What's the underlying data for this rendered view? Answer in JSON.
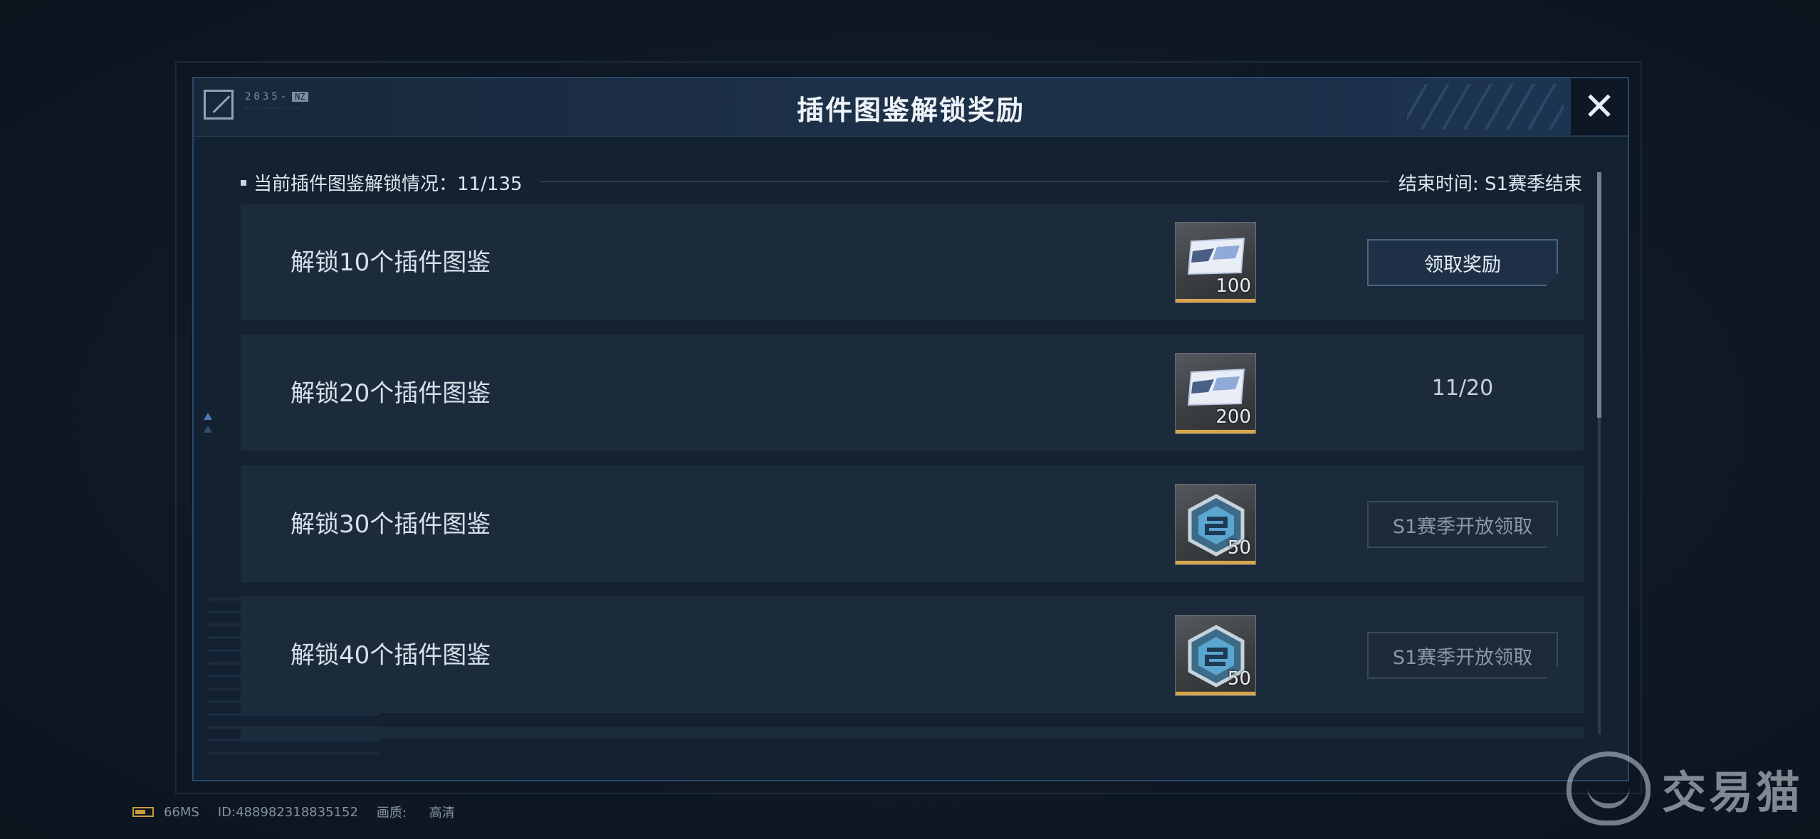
{
  "dialog": {
    "title": "插件图鉴解锁奖励",
    "logo_code": "2035-",
    "logo_tag": "NZ",
    "close_label": "✕"
  },
  "status": {
    "unlock_progress": "当前插件图鉴解锁情况：11/135",
    "end_time": "结束时间: S1赛季结束"
  },
  "rewards": [
    {
      "label": "解锁10个插件图鉴",
      "icon": "ticket-card-icon",
      "count": "100",
      "action": "领取奖励",
      "state": "claimable"
    },
    {
      "label": "解锁20个插件图鉴",
      "icon": "ticket-card-icon",
      "count": "200",
      "progress": "11/20",
      "state": "in-progress"
    },
    {
      "label": "解锁30个插件图鉴",
      "icon": "hex-badge-icon",
      "count": "50",
      "action": "S1赛季开放领取",
      "state": "locked"
    },
    {
      "label": "解锁40个插件图鉴",
      "icon": "hex-badge-icon",
      "count": "50",
      "action": "S1赛季开放领取",
      "state": "locked"
    }
  ],
  "footer": {
    "latency": "66MS",
    "player_id": "ID:488982318835152",
    "quality_label": "画质:",
    "quality_value": "高清"
  },
  "watermark": {
    "text": "交易猫"
  },
  "colors": {
    "panel_bg": "#132131",
    "row_bg": "#1c2b3c",
    "accent_gold": "#d7a54a",
    "border_blue": "#2a4869"
  }
}
